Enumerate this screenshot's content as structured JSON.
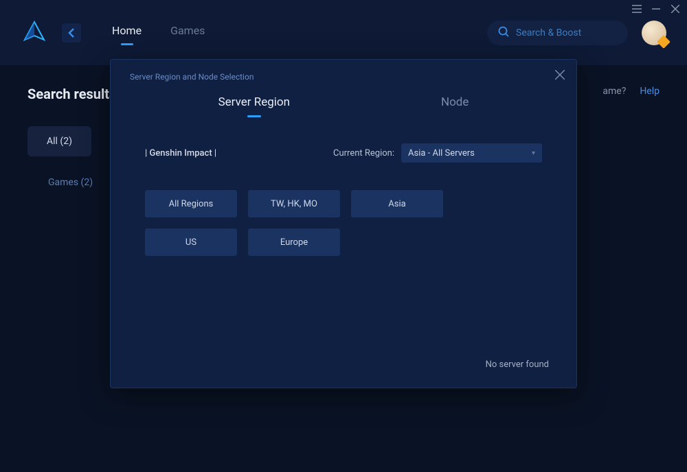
{
  "titleBar": {
    "menuIcon": "menu-icon",
    "minimizeIcon": "minimize-icon",
    "closeIcon": "close-icon"
  },
  "header": {
    "tabs": [
      {
        "label": "Home",
        "active": true
      },
      {
        "label": "Games",
        "active": false
      }
    ],
    "search": {
      "placeholder": "Search & Boost"
    }
  },
  "sidebar": {
    "heading": "Search results",
    "filters": {
      "all": "All (2)",
      "games": "Games (2)"
    }
  },
  "content": {
    "hint": "ame?",
    "help": "Help"
  },
  "modal": {
    "title": "Server Region and Node Selection",
    "tabs": [
      {
        "label": "Server Region",
        "active": true
      },
      {
        "label": "Node",
        "active": false
      }
    ],
    "gameLabel": "| Genshin Impact |",
    "currentRegionLabel": "Current Region:",
    "currentRegionValue": "Asia - All Servers",
    "regions": [
      "All Regions",
      "TW, HK, MO",
      "Asia",
      "US",
      "Europe"
    ],
    "footer": "No server found"
  }
}
